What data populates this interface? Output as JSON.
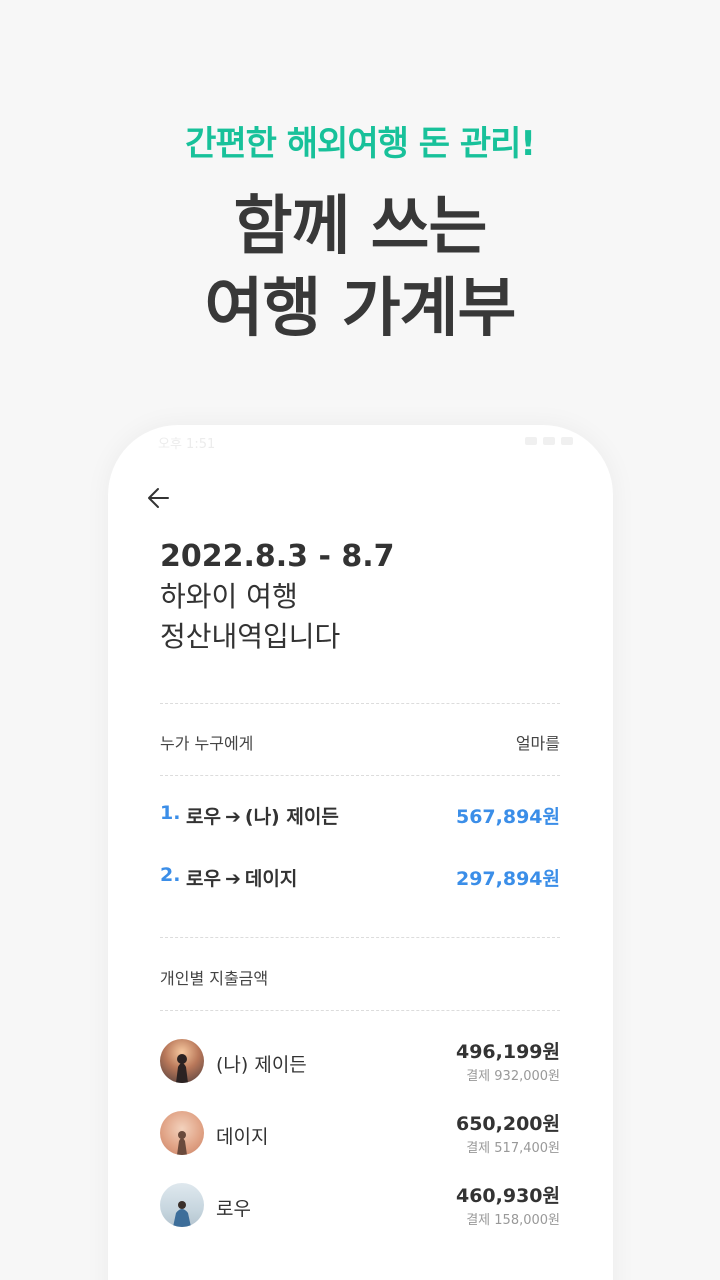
{
  "hero": {
    "subtitle": "간편한 해외여행 돈 관리!",
    "headline_line1": "함께 쓰는",
    "headline_line2": "여행 가계부"
  },
  "colors": {
    "accent_green": "#18c19a",
    "accent_blue": "#3b8ee8",
    "text_dark": "#333333",
    "background": "#f7f7f7"
  },
  "statusbar": {
    "time": "오후 1:51"
  },
  "header": {
    "date_range": "2022.8.3 - 8.7",
    "trip_name": "하와이 여행",
    "caption": "정산내역입니다"
  },
  "settlement": {
    "col_left": "누가 누구에게",
    "col_right": "얼마를",
    "arrow": "➔",
    "items": [
      {
        "index": "1.",
        "from": "로우",
        "to": "(나) 제이든",
        "amount": "567,894원"
      },
      {
        "index": "2.",
        "from": "로우",
        "to": "데이지",
        "amount": "297,894원"
      }
    ]
  },
  "personal": {
    "heading": "개인별 지출금액",
    "people": [
      {
        "name": "(나) 제이든",
        "amount": "496,199원",
        "paid": "결제 932,000원"
      },
      {
        "name": "데이지",
        "amount": "650,200원",
        "paid": "결제 517,400원"
      },
      {
        "name": "로우",
        "amount": "460,930원",
        "paid": "결제 158,000원"
      }
    ]
  }
}
